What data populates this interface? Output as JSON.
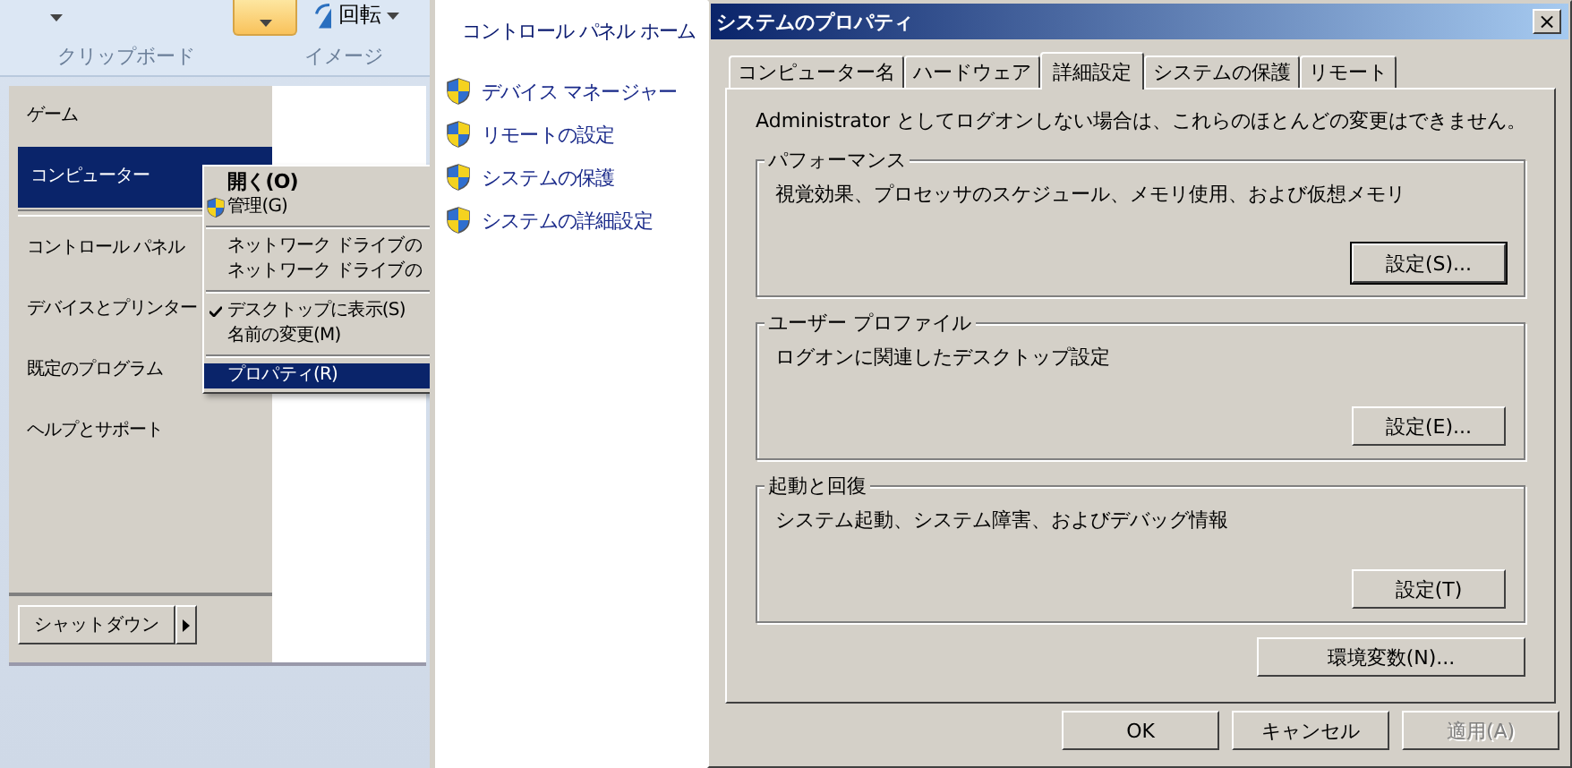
{
  "ribbon": {
    "groups": [
      {
        "label": "クリップボード"
      },
      {
        "label": "イメージ"
      }
    ],
    "rotate_button": {
      "label": "回転"
    }
  },
  "start_menu": {
    "groups": [
      [
        {
          "label": "ゲーム",
          "selected": false
        },
        {
          "label": "コンピューター",
          "selected": true
        }
      ],
      [
        {
          "label": "コントロール パネル",
          "selected": false
        },
        {
          "label": "デバイスとプリンター",
          "selected": false
        },
        {
          "label": "既定のプログラム",
          "selected": false
        },
        {
          "label": "ヘルプとサポート",
          "selected": false
        }
      ]
    ],
    "shutdown": "シャットダウン"
  },
  "context_menu": {
    "groups": [
      [
        {
          "label": "開く(O)",
          "kind": "default",
          "checked": false,
          "selected": false
        },
        {
          "label": "管理(G)",
          "kind": "shield",
          "checked": false,
          "selected": false
        }
      ],
      [
        {
          "label": "ネットワーク ドライブの",
          "kind": "plain",
          "checked": false,
          "selected": false
        },
        {
          "label": "ネットワーク ドライブの",
          "kind": "plain",
          "checked": false,
          "selected": false
        }
      ],
      [
        {
          "label": "デスクトップに表示(S)",
          "kind": "plain",
          "checked": true,
          "selected": false
        },
        {
          "label": "名前の変更(M)",
          "kind": "plain",
          "checked": false,
          "selected": false
        }
      ],
      [
        {
          "label": "プロパティ(R)",
          "kind": "plain",
          "checked": false,
          "selected": true
        }
      ]
    ]
  },
  "control_panel": {
    "home": "コントロール パネル ホーム",
    "links": [
      "デバイス マネージャー",
      "リモートの設定",
      "システムの保護",
      "システムの詳細設定"
    ]
  },
  "dialog": {
    "title": "システムのプロパティ",
    "close": "×",
    "tabs": [
      {
        "label": "コンピューター名",
        "selected": false
      },
      {
        "label": "ハードウェア",
        "selected": false
      },
      {
        "label": "詳細設定",
        "selected": true
      },
      {
        "label": "システムの保護",
        "selected": false
      },
      {
        "label": "リモート",
        "selected": false
      }
    ],
    "note": "Administrator としてログオンしない場合は、これらのほとんどの変更はできません。",
    "groups": [
      {
        "title": "パフォーマンス",
        "description": "視覚効果、プロセッサのスケジュール、メモリ使用、および仮想メモリ",
        "button": "設定(S)...",
        "focused": true
      },
      {
        "title": "ユーザー プロファイル",
        "description": "ログオンに関連したデスクトップ設定",
        "button": "設定(E)...",
        "focused": false
      },
      {
        "title": "起動と回復",
        "description": "システム起動、システム障害、およびデバッグ情報",
        "button": "設定(T)",
        "focused": false
      }
    ],
    "env_button": "環境変数(N)...",
    "buttons": [
      {
        "label": "OK",
        "disabled": false
      },
      {
        "label": "キャンセル",
        "disabled": false
      },
      {
        "label": "適用(A)",
        "disabled": true
      }
    ]
  }
}
